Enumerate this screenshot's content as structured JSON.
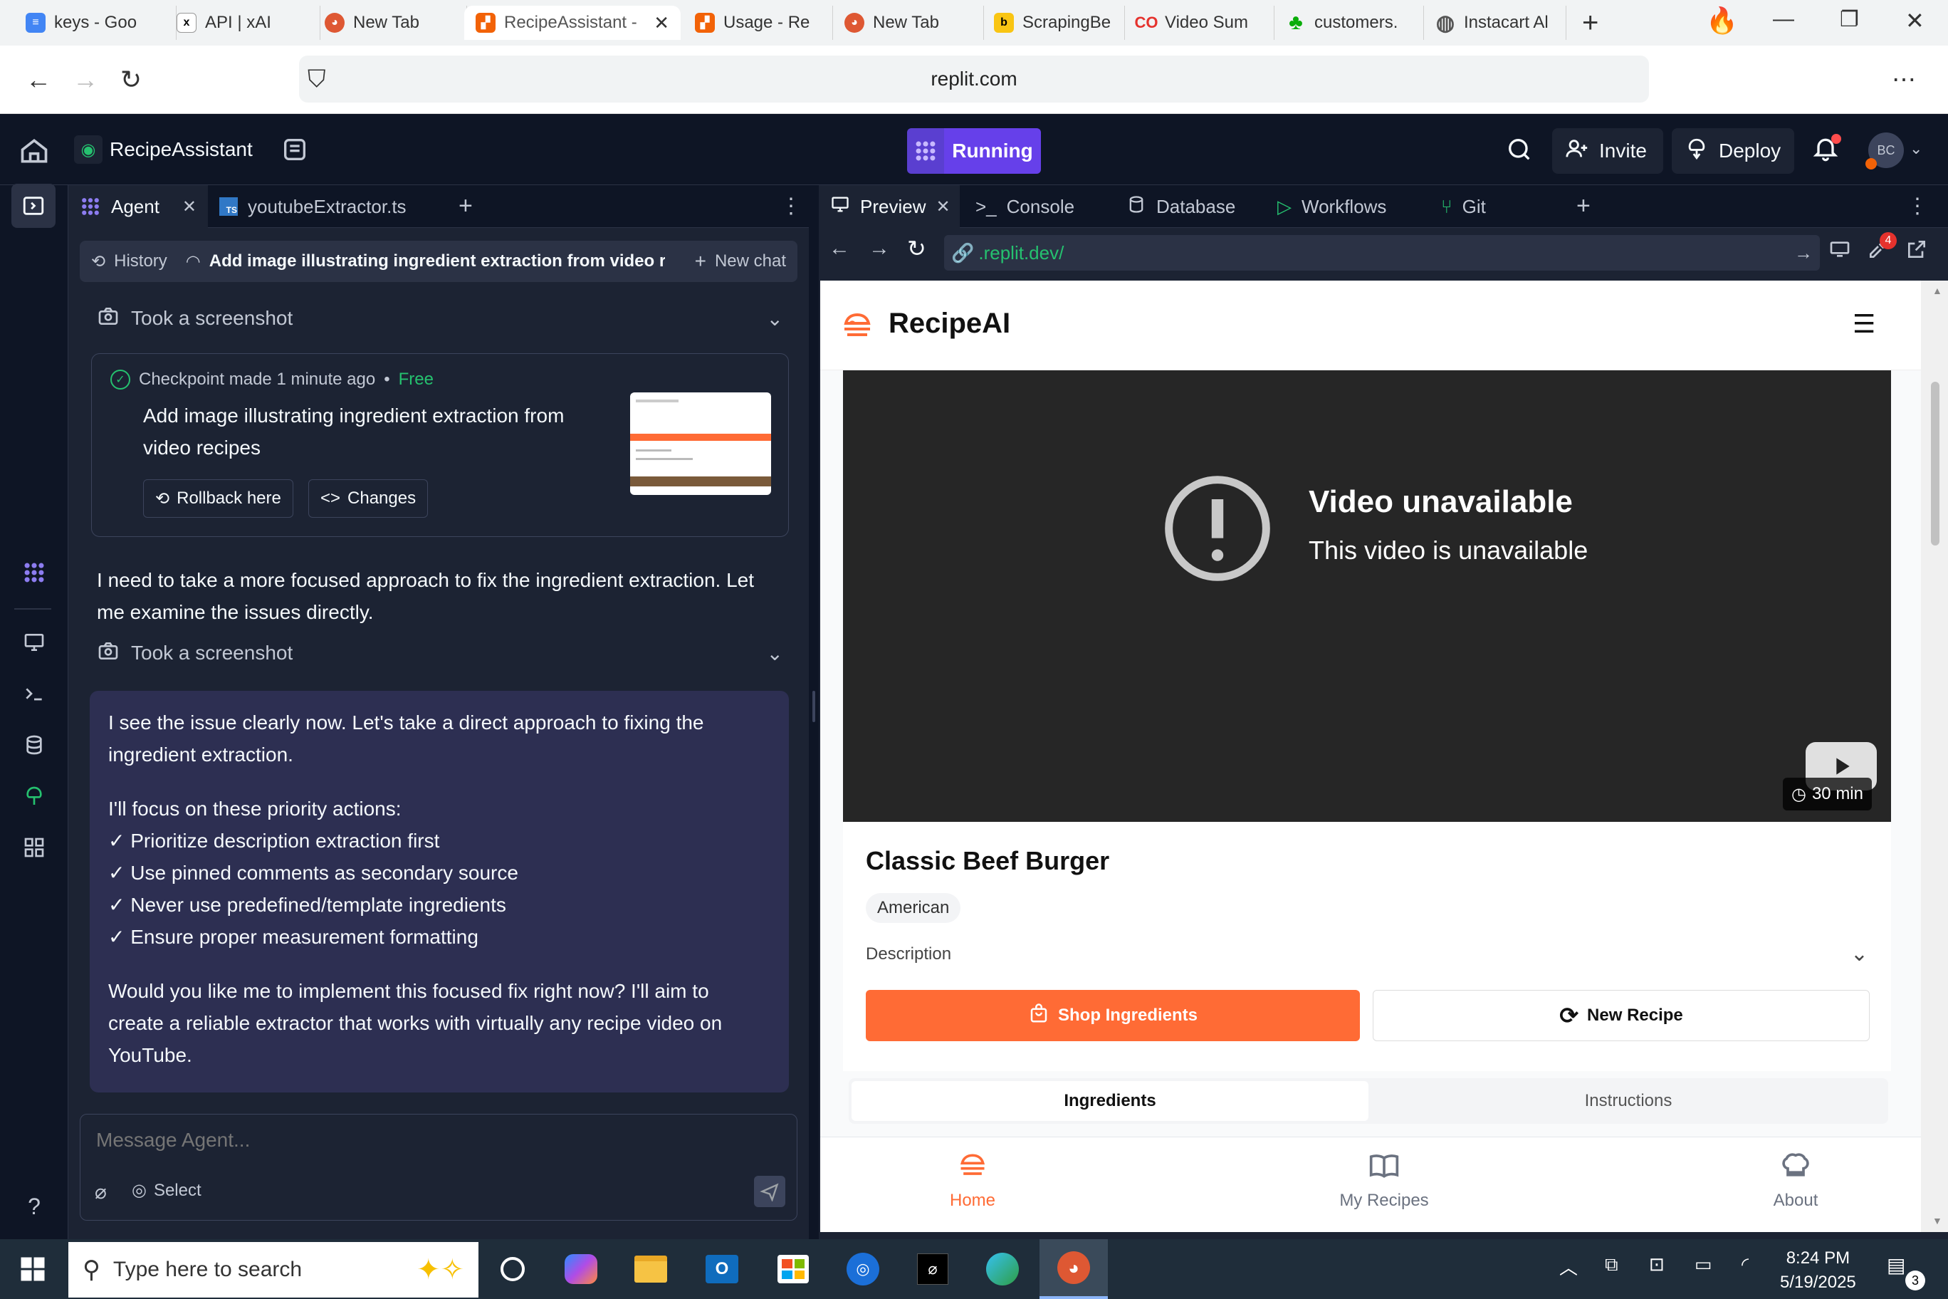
{
  "browser": {
    "tabs": [
      {
        "label": "keys - Goo",
        "icon": "docs-icon",
        "color": "#4285f4"
      },
      {
        "label": "API | xAI",
        "icon": "xai-icon",
        "color": "#000000"
      },
      {
        "label": "New Tab",
        "icon": "duckduckgo-icon",
        "color": "#de5833"
      },
      {
        "label": "RecipeAssistant -",
        "icon": "replit-icon",
        "color": "#f26207",
        "active": true
      },
      {
        "label": "Usage - Re",
        "icon": "replit-icon",
        "color": "#f26207"
      },
      {
        "label": "New Tab",
        "icon": "duckduckgo-icon",
        "color": "#de5833"
      },
      {
        "label": "ScrapingBe",
        "icon": "scrapingbee-icon",
        "color": "#f9c513"
      },
      {
        "label": "Video Sum",
        "icon": "co-icon",
        "color": "#e5322d"
      },
      {
        "label": "customers.",
        "icon": "instacart-icon",
        "color": "#0aad0a"
      },
      {
        "label": "Instacart Al",
        "icon": "globe-icon",
        "color": "#555555"
      }
    ],
    "url": "replit.com"
  },
  "header": {
    "project_name": "RecipeAssistant",
    "run_label": "Running",
    "invite_label": "Invite",
    "deploy_label": "Deploy",
    "avatar_initials": "BC",
    "notif_dot_color": "#ff4d4d"
  },
  "agent": {
    "tabs": [
      {
        "label": "Agent"
      },
      {
        "label": "youtubeExtractor.ts"
      }
    ],
    "history_label": "History",
    "chat_title": "Add image illustrating ingredient extraction from video r...",
    "new_chat_label": "New chat",
    "screenshot_label": "Took a screenshot",
    "checkpoint": {
      "made": "Checkpoint made 1 minute ago",
      "plan": "Free",
      "title_line1": "Add image illustrating ingredient extraction from",
      "title_line2": "video recipes",
      "rollback_label": "Rollback here",
      "changes_label": "Changes"
    },
    "message1_line1": "I need to take a more focused approach to fix the ingredient extraction. Let",
    "message1_line2": "me examine the issues directly.",
    "screenshot2_label": "Took a screenshot",
    "bubble": {
      "p1_line1": "I see the issue clearly now. Let's take a direct approach to fixing the",
      "p1_line2": "ingredient extraction.",
      "p2": "I'll focus on these priority actions:",
      "items": [
        "✓ Prioritize description extraction first",
        "✓ Use pinned comments as secondary source",
        "✓ Never use predefined/template ingredients",
        "✓ Ensure proper measurement formatting"
      ],
      "p3_line1": "Would you like me to implement this focused fix right now? I'll aim to",
      "p3_line2": "create a reliable extractor that works with virtually any recipe video on",
      "p3_line3": "YouTube."
    },
    "input_placeholder": "Message Agent...",
    "select_label": "Select"
  },
  "preview": {
    "tabs": [
      {
        "label": "Preview"
      },
      {
        "label": "Console"
      },
      {
        "label": "Database"
      },
      {
        "label": "Workflows"
      },
      {
        "label": "Git"
      }
    ],
    "url": ".replit.dev/",
    "devtools_badge": "4"
  },
  "webapp": {
    "brand": "RecipeAI",
    "accent": "#ff6b35",
    "video_title": "Video unavailable",
    "video_subtitle": "This video is unavailable",
    "duration": "30 min",
    "recipe_title": "Classic Beef Burger",
    "cuisine": "American",
    "description_label": "Description",
    "shop_label": "Shop Ingredients",
    "new_recipe_label": "New Recipe",
    "tab_ingredients": "Ingredients",
    "tab_instructions": "Instructions",
    "nav": [
      {
        "label": "Home",
        "active": true
      },
      {
        "label": "My Recipes"
      },
      {
        "label": "About"
      }
    ]
  },
  "taskbar": {
    "search_placeholder": "Type here to search",
    "time": "8:24 PM",
    "date": "5/19/2025",
    "notif_count": "3"
  }
}
